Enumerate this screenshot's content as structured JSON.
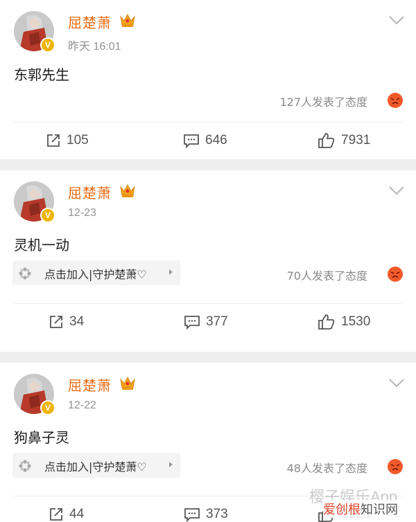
{
  "posts": [
    {
      "author": "屈楚萧",
      "time": "昨天 16:01",
      "text": "东郭先生",
      "fan_group": null,
      "attitude": "127人发表了态度",
      "repost": "105",
      "comment": "646",
      "like": "7931"
    },
    {
      "author": "屈楚萧",
      "time": "12-23",
      "text": "灵机一动",
      "fan_group": "点击加入|守护楚萧♡",
      "attitude": "70人发表了态度",
      "repost": "34",
      "comment": "377",
      "like": "1530"
    },
    {
      "author": "屈楚萧",
      "time": "12-22",
      "text": "狗鼻子灵",
      "fan_group": "点击加入|守护楚萧♡",
      "attitude": "48人发表了态度",
      "repost": "44",
      "comment": "373",
      "like": "1220"
    }
  ],
  "watermark": {
    "overlay": "樱子娱乐App",
    "site_a": "爱创根",
    "site_b": "知识网"
  },
  "colors": {
    "username": "#e86b12",
    "verified_badge": "#f0b400",
    "angry_emoji": "#f05a2a",
    "separator": "#eeeeee"
  },
  "icons": [
    "crown-icon",
    "verified-icon",
    "chevron-down-icon",
    "flower-icon",
    "angry-emoji-icon",
    "repost-icon",
    "comment-icon",
    "like-icon"
  ]
}
